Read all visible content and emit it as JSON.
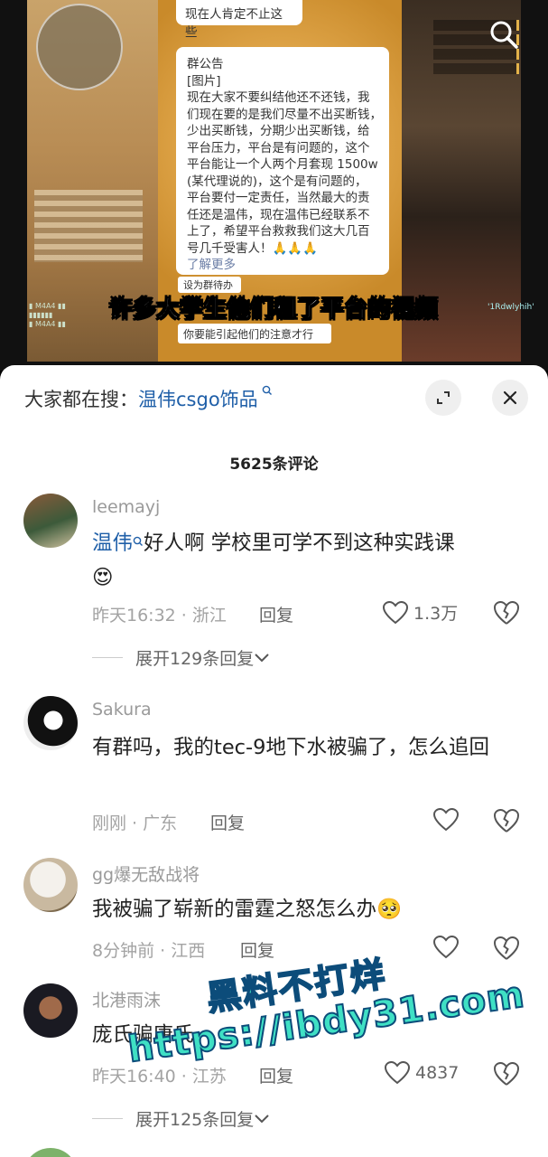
{
  "video": {
    "top_bubble": "现在人肯定不止这些",
    "notice_lines": [
      "群公告",
      "[图片]",
      "现在大家不要纠结他还不还钱，我",
      "们现在要的是我们尽量不出买断钱，",
      "少出买断钱，分期少出买断钱，给",
      "平台压力，平台是有问题的，这个",
      "平台能让一个人两个月套现 1500w",
      "(某代理说的)，这个是有问题的，",
      "平台要付一定责任，当然最大的责",
      "任还是温伟，现在温伟已经联系不",
      "上了，希望平台救救我们这大几百",
      "号几千受害人！🙏🙏🙏"
    ],
    "notice_more": "了解更多",
    "small_tag": "设为群待办",
    "small_tag2": "你要能引起他们的注意才行",
    "subtitle": "许多大学生他们租了平台的视频",
    "mark_right": "'1Rdwlyhih'"
  },
  "sheet": {
    "search_prefix": "大家都在搜：",
    "search_keyword": "温伟csgo饰品",
    "search_q_icon": "search-small-icon",
    "comment_count": "5625条评论",
    "expand_icon": "expand-icon",
    "close_icon": "close-icon"
  },
  "comments": [
    {
      "username": "leemayj",
      "mention": "温伟",
      "text": "好人啊 学校里可学不到这种实践课",
      "emoji": "😍",
      "meta": "昨天16:32 · 浙江",
      "reply": "回复",
      "likes": "1.3万",
      "expand": "展开129条回复"
    },
    {
      "username": "Sakura",
      "text": "有群吗，我的tec-9地下水被骗了，怎么追回",
      "meta": "刚刚 · 广东",
      "reply": "回复"
    },
    {
      "username": "gg爆无敌战将",
      "text": "我被骗了崭新的雷霆之怒怎么办🥺",
      "meta": "8分钟前 · 江西",
      "reply": "回复"
    },
    {
      "username": "北港雨沫",
      "text": "庞氏骗唐氏",
      "meta": "昨天16:40 · 江苏",
      "reply": "回复",
      "likes": "4837",
      "expand": "展开125条回复"
    }
  ],
  "watermark": {
    "line1": "黑料不打烊",
    "line2": "https://ibdy31.com"
  },
  "colors": {
    "link": "#1f5fa8",
    "watermark_fill": "#3fe0c4",
    "watermark_stroke": "#0c4c7a"
  }
}
